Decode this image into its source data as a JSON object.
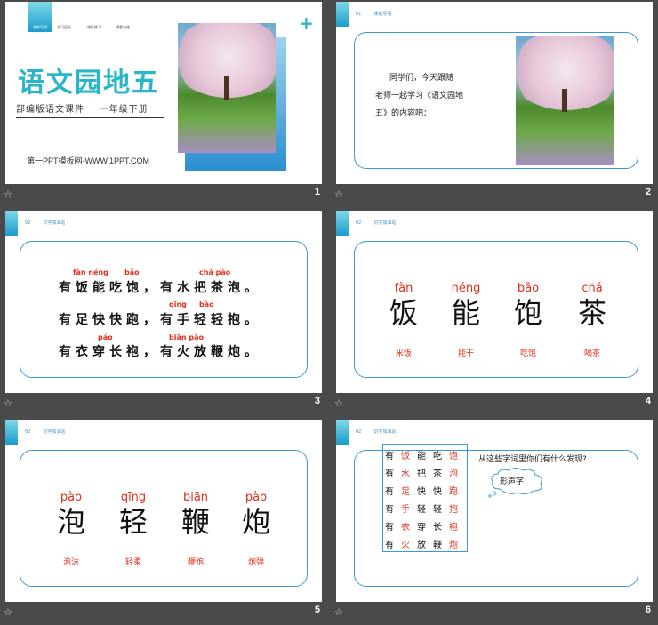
{
  "slides": [
    {
      "number": "1",
      "nav": [
        "课前导语",
        "学习目标",
        "课后练习",
        "课堂小结"
      ],
      "title": "语文园地五",
      "subtitle": "部编版语文课件    一年级下册",
      "footer_text": "第一PPT模板网-WWW.1PPT.COM",
      "plus": "+"
    },
    {
      "number": "2",
      "header": [
        "01",
        "课前导语"
      ],
      "body": [
        "同学们，今天跟随",
        "老师一起学习《语文园地",
        "五》的内容吧："
      ]
    },
    {
      "number": "3",
      "header": [
        "02",
        "识字加油站"
      ],
      "rows": [
        "有饭能吃饱，有水把茶泡。",
        "有足快快跑，有手轻轻抱。",
        "有衣穿长袍，有火放鞭炮。"
      ],
      "pinyin": [
        "fàn néng",
        "bǎo",
        "chá pào",
        "qīng",
        "bào",
        "páo",
        "biān pào"
      ]
    },
    {
      "number": "4",
      "header": [
        "02",
        "识字加油站"
      ],
      "cells": [
        {
          "pinyin": "fàn",
          "char": "饭",
          "word": "米饭"
        },
        {
          "pinyin": "néng",
          "char": "能",
          "word": "能干"
        },
        {
          "pinyin": "bǎo",
          "char": "饱",
          "word": "吃饱"
        },
        {
          "pinyin": "chá",
          "char": "茶",
          "word": "喝茶"
        }
      ]
    },
    {
      "number": "5",
      "header": [
        "02",
        "识字加油站"
      ],
      "cells": [
        {
          "pinyin": "pào",
          "char": "泡",
          "word": "泡沫"
        },
        {
          "pinyin": "qīng",
          "char": "轻",
          "word": "轻柔"
        },
        {
          "pinyin": "biān",
          "char": "鞭",
          "word": "鞭炮"
        },
        {
          "pinyin": "pào",
          "char": "炮",
          "word": "炮弹"
        }
      ]
    },
    {
      "number": "6",
      "header": [
        "02",
        "识字加油站"
      ],
      "grid": [
        [
          "有",
          "饭",
          "能",
          "吃",
          "饱"
        ],
        [
          "有",
          "水",
          "把",
          "茶",
          "泡"
        ],
        [
          "有",
          "足",
          "快",
          "快",
          "跑"
        ],
        [
          "有",
          "手",
          "轻",
          "轻",
          "抱"
        ],
        [
          "有",
          "衣",
          "穿",
          "长",
          "袍"
        ],
        [
          "有",
          "火",
          "放",
          "鞭",
          "炮"
        ]
      ],
      "question": "从这些字词里你们有什么发现?",
      "bubble": "形声字"
    }
  ],
  "footer_icon": "star-icon",
  "colors": {
    "accent": "#3a9ad9",
    "red": "#e0301e",
    "teal": "#29b6c8",
    "bg": "#4a4a4a"
  }
}
